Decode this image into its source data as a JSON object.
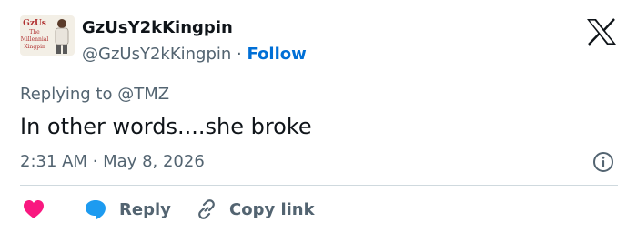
{
  "author": {
    "display_name": "GzUsY2kKingpin",
    "handle": "@GzUsY2kKingpin",
    "separator": "·",
    "follow_label": "Follow",
    "avatar_text": [
      "GzUs",
      "The",
      "Millennial",
      "Kingpin"
    ]
  },
  "tweet": {
    "replying_prefix": "Replying to",
    "replying_to": "@TMZ",
    "text": "In other words....she broke",
    "timestamp": "2:31 AM · May 8, 2026"
  },
  "actions": {
    "reply_label": "Reply",
    "copy_link_label": "Copy link"
  },
  "icons": {
    "brand": "x-logo-icon",
    "info": "info-icon",
    "like": "heart-icon",
    "reply": "speech-bubble-icon",
    "copy": "link-icon"
  },
  "colors": {
    "text_primary": "#0f1419",
    "text_secondary": "#536471",
    "follow_blue": "#006fd6",
    "heart_pink": "#f91880",
    "reply_blue": "#1d9bf0",
    "divider": "#cfd9de"
  }
}
